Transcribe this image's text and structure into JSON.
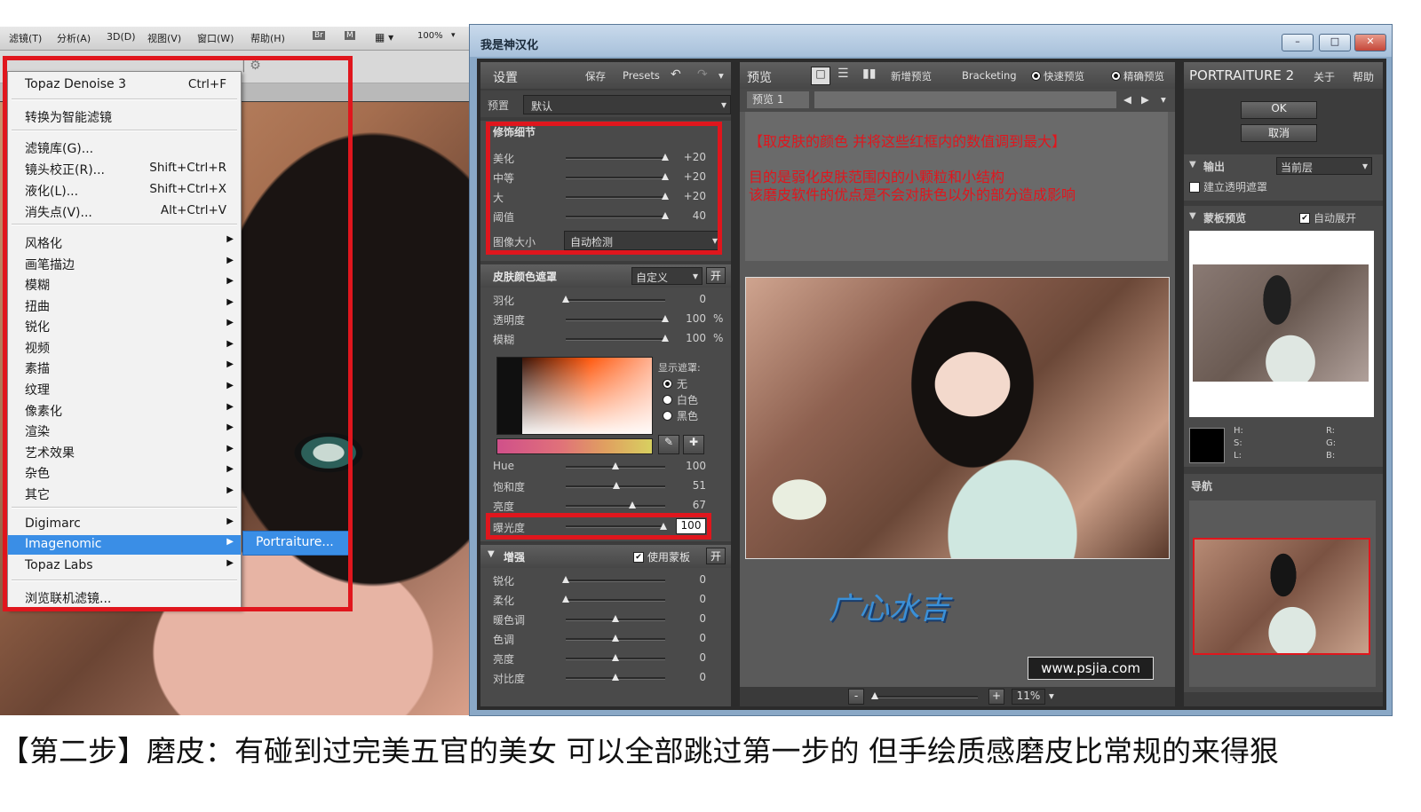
{
  "photoshop": {
    "menubar": [
      "滤镜(T)",
      "分析(A)",
      "3D(D)",
      "视图(V)",
      "窗口(W)",
      "帮助(H)",
      "Br",
      "M",
      "100%"
    ],
    "menu": {
      "items": [
        {
          "label": "Topaz Denoise 3",
          "shortcut": "Ctrl+F"
        },
        {
          "label": "转换为智能滤镜"
        },
        {
          "label": "滤镜库(G)..."
        },
        {
          "label": "镜头校正(R)...",
          "shortcut": "Shift+Ctrl+R"
        },
        {
          "label": "液化(L)...",
          "shortcut": "Shift+Ctrl+X"
        },
        {
          "label": "消失点(V)...",
          "shortcut": "Alt+Ctrl+V"
        },
        {
          "label": "风格化"
        },
        {
          "label": "画笔描边"
        },
        {
          "label": "模糊"
        },
        {
          "label": "扭曲"
        },
        {
          "label": "锐化"
        },
        {
          "label": "视频"
        },
        {
          "label": "素描"
        },
        {
          "label": "纹理"
        },
        {
          "label": "像素化"
        },
        {
          "label": "渲染"
        },
        {
          "label": "艺术效果"
        },
        {
          "label": "杂色"
        },
        {
          "label": "其它"
        },
        {
          "label": "Digimarc"
        },
        {
          "label": "Imagenomic"
        },
        {
          "label": "Topaz Labs"
        },
        {
          "label": "浏览联机滤镜..."
        }
      ],
      "submenu_item": "Portraiture..."
    }
  },
  "portraiture": {
    "window_title": "我是神汉化",
    "window_buttons": [
      "–",
      "□",
      "✕"
    ],
    "settings_bar": {
      "title": "设置",
      "save": "保存",
      "presets": "Presets"
    },
    "preset": {
      "label": "预置",
      "value": "默认"
    },
    "detail": {
      "title": "修饰细节",
      "rows": [
        {
          "label": "美化",
          "value": "+20",
          "pos": 1.0
        },
        {
          "label": "中等",
          "value": "+20",
          "pos": 1.0
        },
        {
          "label": "大",
          "value": "+20",
          "pos": 1.0
        },
        {
          "label": "阈值",
          "value": "40",
          "pos": 1.0
        }
      ],
      "image_size_label": "图像大小",
      "image_size_value": "自动检测"
    },
    "skin": {
      "title": "皮肤颜色遮罩",
      "mode": "自定义",
      "toggle": "开",
      "rows": [
        {
          "label": "羽化",
          "value": "0",
          "unit": "",
          "pos": 0.0
        },
        {
          "label": "透明度",
          "value": "100",
          "unit": "%",
          "pos": 1.0
        },
        {
          "label": "模糊",
          "value": "100",
          "unit": "%",
          "pos": 1.0
        }
      ],
      "show_mask_label": "显示遮罩:",
      "mask_options": [
        "无",
        "白色",
        "黑色"
      ],
      "hsl_rows": [
        {
          "label": "Hue",
          "value": "100",
          "pos": 0.5
        },
        {
          "label": "饱和度",
          "value": "51",
          "pos": 0.51
        },
        {
          "label": "亮度",
          "value": "67",
          "pos": 0.67
        }
      ],
      "exposure_label": "曝光度",
      "exposure_value": "100"
    },
    "enhance": {
      "title": "增强",
      "use_mask": "使用蒙板",
      "toggle": "开",
      "rows": [
        {
          "label": "锐化",
          "value": "0",
          "pos": 0.0
        },
        {
          "label": "柔化",
          "value": "0",
          "pos": 0.0
        },
        {
          "label": "暖色调",
          "value": "0",
          "pos": 0.5
        },
        {
          "label": "色调",
          "value": "0",
          "pos": 0.5
        },
        {
          "label": "亮度",
          "value": "0",
          "pos": 0.5
        },
        {
          "label": "对比度",
          "value": "0",
          "pos": 0.5
        }
      ]
    },
    "preview_bar": {
      "title": "预览",
      "new_preview": "新增预览",
      "bracketing": "Bracketing",
      "fast": "快速预览",
      "accurate": "精确预览"
    },
    "preview_tab": "预览    1",
    "annotation": {
      "line1": "【取皮肤的颜色  并将这些红框内的数值调到最大】",
      "line2": "目的是弱化皮肤范围内的小颗粒和小结构",
      "line3": "该磨皮软件的优点是不会对肤色以外的部分造成影响"
    },
    "watermark_url": "www.psjia.com",
    "logo_text": "广心水吉",
    "zoom": {
      "minus": "-",
      "plus": "+",
      "value": "11%"
    },
    "right": {
      "brand": "PORTRAITURE 2",
      "about": "关于",
      "help": "帮助",
      "ok": "OK",
      "cancel": "取消",
      "output_label": "输出",
      "output_value": "当前层",
      "transparency": "建立透明遮罩",
      "mask_preview": "蒙板预览",
      "auto_expand": "自动展开",
      "hsl_letters": [
        "H:",
        "S:",
        "L:"
      ],
      "rgb_letters": [
        "R:",
        "G:",
        "B:"
      ],
      "navigator": "导航"
    },
    "accent_red": "#e0161d"
  },
  "caption": "【第二步】磨皮：有碰到过完美五官的美女 可以全部跳过第一步的 但手绘质感磨皮比常规的来得狠"
}
